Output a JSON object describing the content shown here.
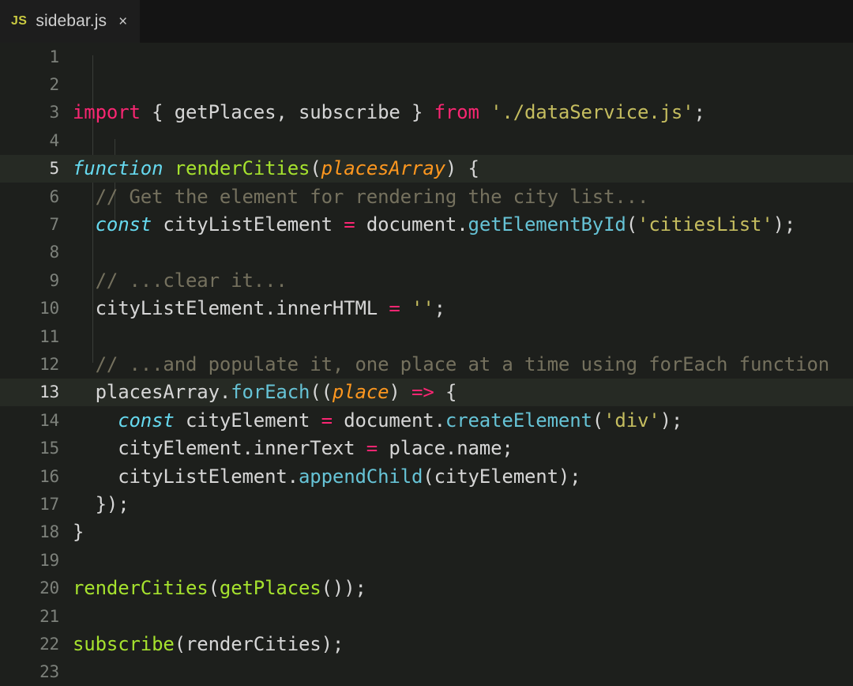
{
  "window": {
    "title": "sidebar.js",
    "background": "#1d1f1c"
  },
  "tabbar": {
    "background": "#141414",
    "tabs": [
      {
        "badge": "JS",
        "badge_color": "#cbcb41",
        "label": "sidebar.js",
        "close_label": "×",
        "active": true
      }
    ]
  },
  "editor": {
    "language": "javascript",
    "font_size_px": 24,
    "line_height_px": 35.4,
    "highlighted_lines": [
      5,
      13
    ],
    "first_line": 1,
    "last_line": 23,
    "theme": {
      "background": "#1d1f1c",
      "line_highlight": "#262a24",
      "gutter_text": "#7d817b",
      "gutter_text_active": "#d8d8d8",
      "default_text": "#d6d6d6",
      "keyword": "#f92672",
      "declaration": "#66d9ef",
      "function_name": "#a6e22e",
      "parameter": "#fd971f",
      "method": "#66c3d6",
      "string": "#c5bd5f",
      "comment": "#75715e",
      "indent_guide": "#3a3d38"
    },
    "lines": [
      {
        "n": "1",
        "text": ""
      },
      {
        "n": "2",
        "text": ""
      },
      {
        "n": "3",
        "text": "import { getPlaces, subscribe } from './dataService.js';"
      },
      {
        "n": "4",
        "text": ""
      },
      {
        "n": "5",
        "text": "function renderCities(placesArray) {"
      },
      {
        "n": "6",
        "text": "  // Get the element for rendering the city list..."
      },
      {
        "n": "7",
        "text": "  const cityListElement = document.getElementById('citiesList');"
      },
      {
        "n": "8",
        "text": ""
      },
      {
        "n": "9",
        "text": "  // ...clear it..."
      },
      {
        "n": "10",
        "text": "  cityListElement.innerHTML = '';"
      },
      {
        "n": "11",
        "text": ""
      },
      {
        "n": "12",
        "text": "  // ...and populate it, one place at a time using forEach function"
      },
      {
        "n": "13",
        "text": "  placesArray.forEach((place) => {"
      },
      {
        "n": "14",
        "text": "    const cityElement = document.createElement('div');"
      },
      {
        "n": "15",
        "text": "    cityElement.innerText = place.name;"
      },
      {
        "n": "16",
        "text": "    cityListElement.appendChild(cityElement);"
      },
      {
        "n": "17",
        "text": "  });"
      },
      {
        "n": "18",
        "text": "}"
      },
      {
        "n": "19",
        "text": ""
      },
      {
        "n": "20",
        "text": "renderCities(getPlaces());"
      },
      {
        "n": "21",
        "text": ""
      },
      {
        "n": "22",
        "text": "subscribe(renderCities);"
      },
      {
        "n": "23",
        "text": ""
      }
    ]
  }
}
